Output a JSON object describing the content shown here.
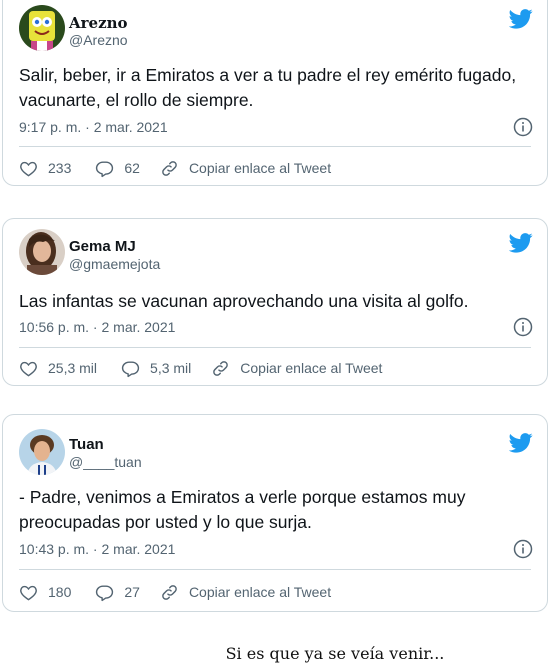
{
  "tweets": [
    {
      "name": "Arezno",
      "handle": "@Arezno",
      "text": "Salir, beber, ir a Emiratos a ver a tu padre el rey emérito fugado, vacunarte, el rollo de siempre.",
      "timestamp": "9:17 p. m. · 2 mar. 2021",
      "likes": "233",
      "replies": "62",
      "copy_link": "Copiar enlace al Tweet",
      "avatar_icon": "spongebob-avatar"
    },
    {
      "name": "Gema MJ",
      "handle": "@gmaemejota",
      "text": "Las infantas se vacunan aprovechando una visita al golfo.",
      "timestamp": "10:56 p. m. · 2 mar. 2021",
      "likes": "25,3 mil",
      "replies": "5,3 mil",
      "copy_link": "Copiar enlace al Tweet",
      "avatar_icon": "woman-photo-avatar"
    },
    {
      "name": "Tuan",
      "handle": "@____tuan",
      "text": "- Padre, venimos a Emiratos a verle porque estamos muy preocupadas por usted y lo que surja.",
      "timestamp": "10:43 p. m. · 2 mar. 2021",
      "likes": "180",
      "replies": "27",
      "copy_link": "Copiar enlace al Tweet",
      "avatar_icon": "footballer-photo-avatar"
    }
  ],
  "caption": "Si es que ya se veía venir...",
  "colors": {
    "twitter_blue": "#1d9bf0",
    "secondary_text": "#536471",
    "border": "#cfd9de"
  }
}
